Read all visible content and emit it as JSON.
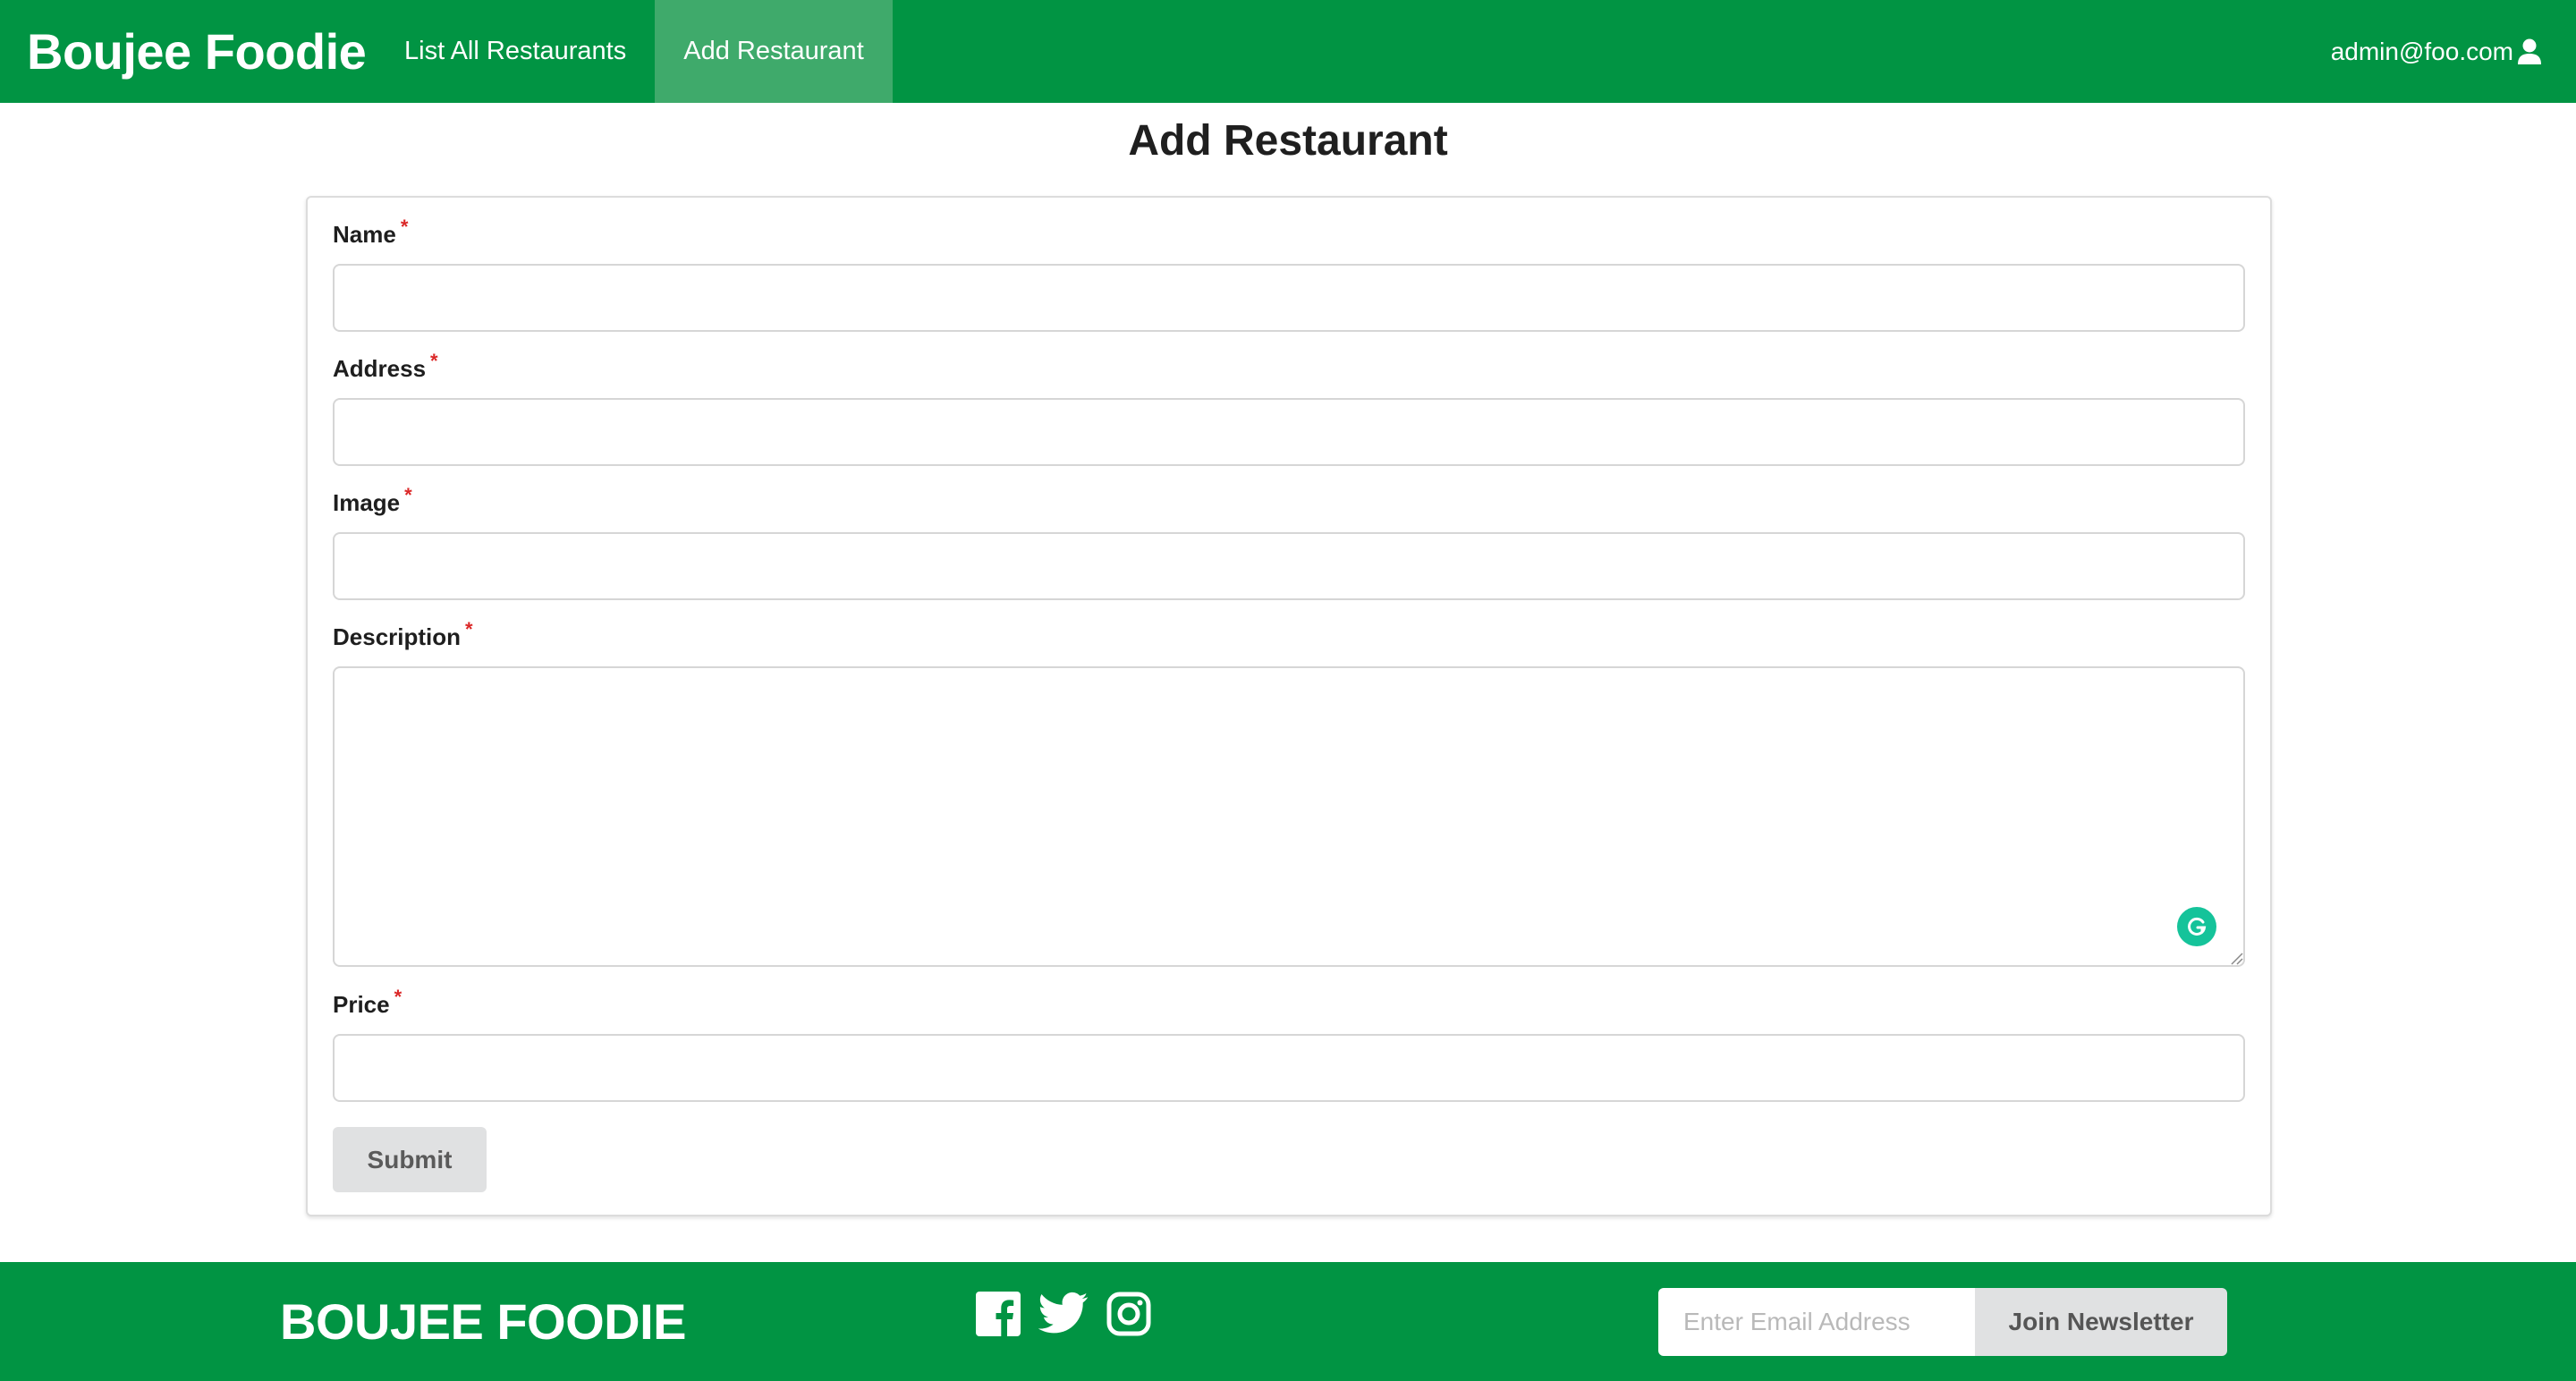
{
  "navbar": {
    "brand": "Boujee Foodie",
    "items": [
      {
        "label": "List All Restaurants",
        "active": false
      },
      {
        "label": "Add Restaurant",
        "active": true
      }
    ],
    "user_email": "admin@foo.com",
    "user_icon": "user-icon"
  },
  "page": {
    "title": "Add Restaurant"
  },
  "form": {
    "required_marker": "*",
    "fields": {
      "name": {
        "label": "Name",
        "value": ""
      },
      "address": {
        "label": "Address",
        "value": ""
      },
      "image": {
        "label": "Image",
        "value": ""
      },
      "description": {
        "label": "Description",
        "value": ""
      },
      "price": {
        "label": "Price",
        "value": ""
      }
    },
    "submit_label": "Submit",
    "grammarly_icon": "grammarly-icon"
  },
  "footer": {
    "brand": "BOUJEE FOODIE",
    "social_icons": [
      "facebook-icon",
      "twitter-icon",
      "instagram-icon"
    ],
    "newsletter": {
      "placeholder": "Enter Email Address",
      "button_label": "Join Newsletter"
    }
  },
  "colors": {
    "brand_green": "#019443",
    "active_tab": "#3faa6b",
    "required": "#db2828",
    "button_gray": "#e0e1e2",
    "grammarly": "#15c39a"
  }
}
